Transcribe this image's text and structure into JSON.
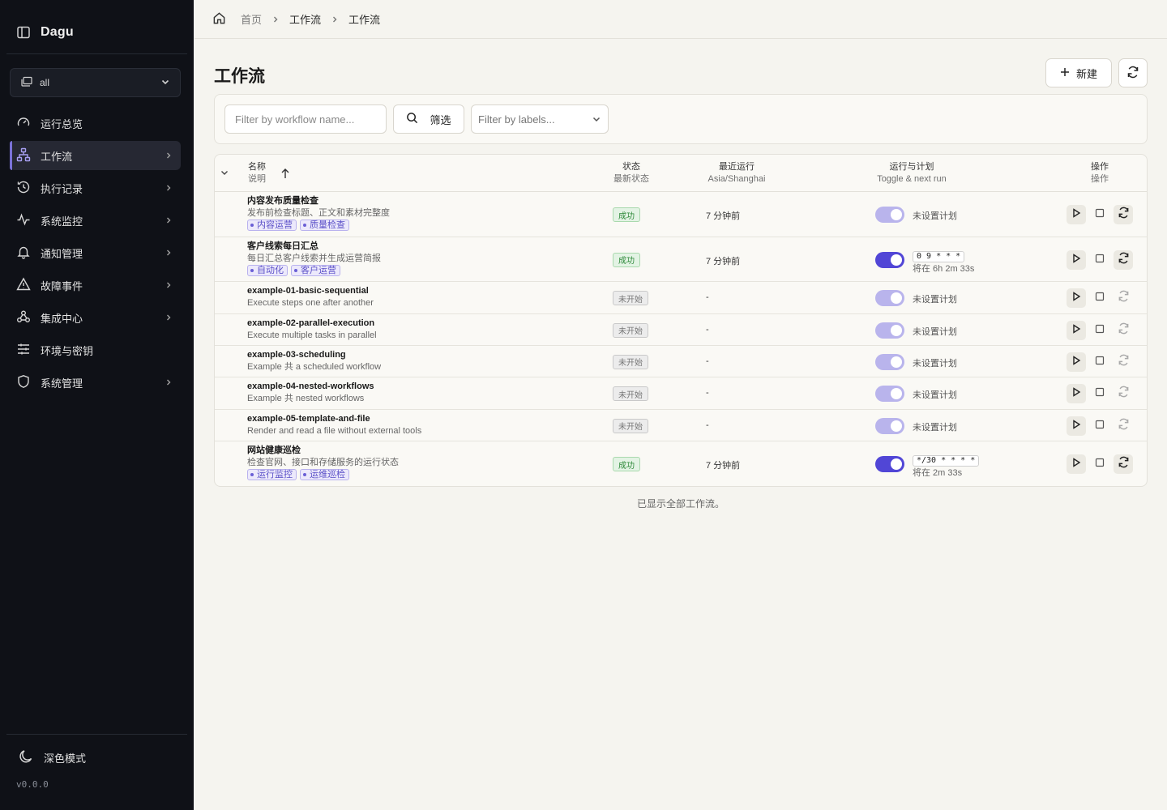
{
  "app": {
    "brand": "Dagu",
    "version": "v0.0.0",
    "theme_toggle": "深色模式"
  },
  "workspace": {
    "selected": "all"
  },
  "sidebar": {
    "items": [
      {
        "label": "运行总览",
        "icon": "gauge-icon",
        "has_arrow": false
      },
      {
        "label": "工作流",
        "icon": "workflow-icon",
        "has_arrow": true,
        "active": true
      },
      {
        "label": "执行记录",
        "icon": "history-icon",
        "has_arrow": true
      },
      {
        "label": "系统监控",
        "icon": "activity-icon",
        "has_arrow": true
      },
      {
        "label": "通知管理",
        "icon": "bell-icon",
        "has_arrow": true
      },
      {
        "label": "故障事件",
        "icon": "alert-triangle-icon",
        "has_arrow": true
      },
      {
        "label": "集成中心",
        "icon": "webhook-icon",
        "has_arrow": true
      },
      {
        "label": "环境与密钥",
        "icon": "sliders-icon",
        "has_arrow": false
      },
      {
        "label": "系统管理",
        "icon": "shield-icon",
        "has_arrow": true
      }
    ]
  },
  "breadcrumb": {
    "home": "首页",
    "section": "工作流",
    "current": "工作流"
  },
  "page": {
    "title": "工作流",
    "new_button": "新建",
    "all_shown": "已显示全部工作流。"
  },
  "filters": {
    "name_placeholder": "Filter by workflow name...",
    "filter_button": "筛选",
    "labels_placeholder": "Filter by labels..."
  },
  "table": {
    "headers": {
      "name": "名称",
      "name_sub": "说明",
      "status": "状态",
      "status_sub": "最新状态",
      "last_run": "最近运行",
      "last_run_sub": "Asia/Shanghai",
      "schedule": "运行与计划",
      "schedule_sub": "Toggle & next run",
      "actions": "操作",
      "actions_sub": "操作"
    },
    "rows": [
      {
        "name": "内容发布质量检查",
        "desc": "发布前检查标题、正文和素材完整度",
        "tags": [
          "内容运营",
          "质量检查"
        ],
        "status": "成功",
        "status_type": "ok",
        "last_run": "7 分钟前",
        "toggle": "off",
        "schedule": "未设置计划",
        "cron": "",
        "next": ""
      },
      {
        "name": "客户线索每日汇总",
        "desc": "每日汇总客户线索并生成运营简报",
        "tags": [
          "自动化",
          "客户运营"
        ],
        "status": "成功",
        "status_type": "ok",
        "last_run": "7 分钟前",
        "toggle": "on",
        "schedule": "",
        "cron": "0 9 * * *",
        "next": "将在 6h 2m 33s"
      },
      {
        "name": "example-01-basic-sequential",
        "desc": "Execute steps one after another",
        "tags": [],
        "status": "未开始",
        "status_type": "idle",
        "last_run": "-",
        "toggle": "off",
        "schedule": "未设置计划",
        "cron": "",
        "next": ""
      },
      {
        "name": "example-02-parallel-execution",
        "desc": "Execute multiple tasks in parallel",
        "tags": [],
        "status": "未开始",
        "status_type": "idle",
        "last_run": "-",
        "toggle": "off",
        "schedule": "未设置计划",
        "cron": "",
        "next": ""
      },
      {
        "name": "example-03-scheduling",
        "desc": "Example 共 a scheduled workflow",
        "tags": [],
        "status": "未开始",
        "status_type": "idle",
        "last_run": "-",
        "toggle": "off",
        "schedule": "未设置计划",
        "cron": "",
        "next": ""
      },
      {
        "name": "example-04-nested-workflows",
        "desc": "Example 共 nested workflows",
        "tags": [],
        "status": "未开始",
        "status_type": "idle",
        "last_run": "-",
        "toggle": "off",
        "schedule": "未设置计划",
        "cron": "",
        "next": ""
      },
      {
        "name": "example-05-template-and-file",
        "desc": "Render and read a file without external tools",
        "tags": [],
        "status": "未开始",
        "status_type": "idle",
        "last_run": "-",
        "toggle": "off",
        "schedule": "未设置计划",
        "cron": "",
        "next": ""
      },
      {
        "name": "网站健康巡检",
        "desc": "检查官网、接口和存储服务的运行状态",
        "tags": [
          "运行监控",
          "运维巡检"
        ],
        "status": "成功",
        "status_type": "ok",
        "last_run": "7 分钟前",
        "toggle": "on",
        "schedule": "",
        "cron": "*/30 * * * *",
        "next": "将在 2m 33s"
      }
    ]
  },
  "colors": {
    "sidebar_bg": "#0f1117",
    "accent": "#5146d6",
    "success": "#2f8a3a",
    "page_bg": "#f5f4ef"
  }
}
